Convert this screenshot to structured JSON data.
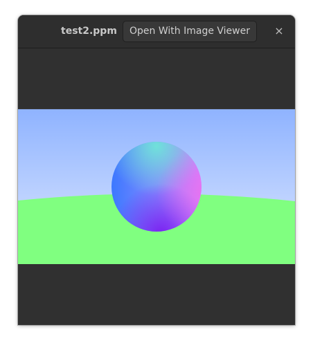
{
  "window": {
    "title": "test2.ppm",
    "open_button_label": "Open With Image Viewer",
    "close_glyph": "×"
  },
  "image": {
    "description_icon": "raytraced-sphere-image",
    "sky_top_color": "#8fb3ff",
    "sky_bottom_color": "#d9e6ff",
    "ground_color": "#80ff80"
  }
}
